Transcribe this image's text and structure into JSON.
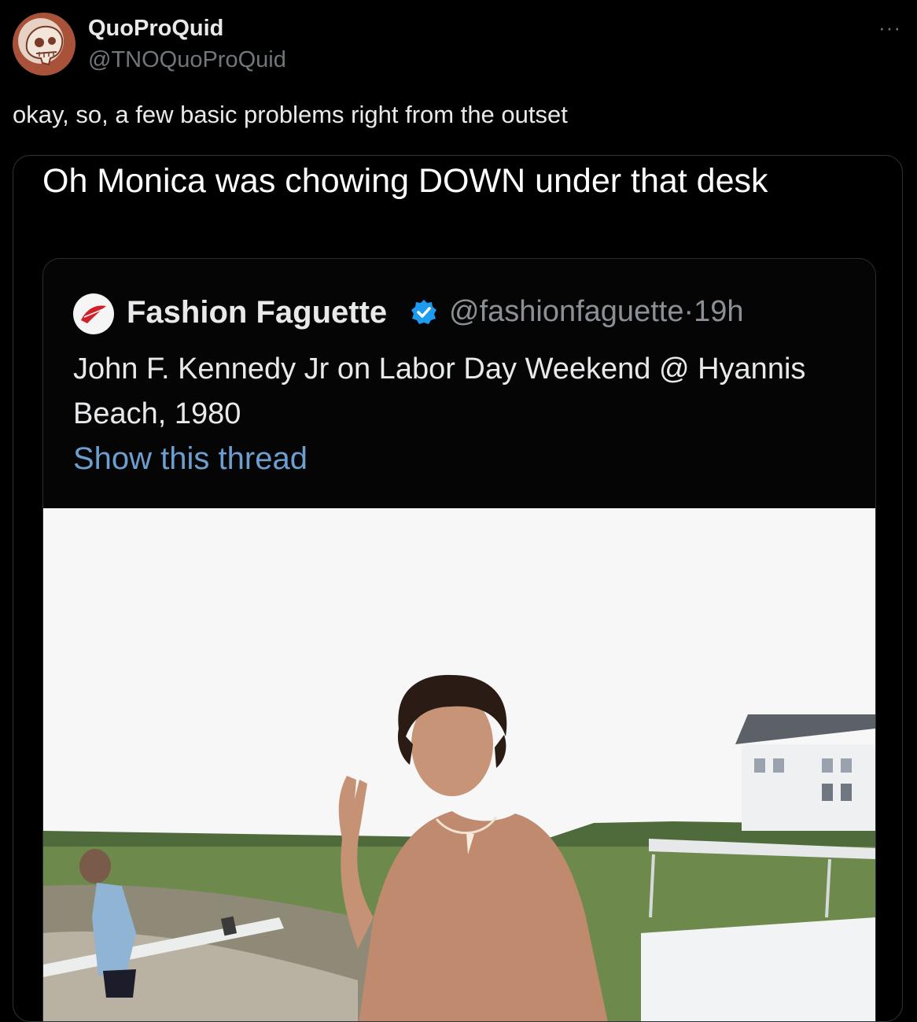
{
  "tweet": {
    "author": {
      "display_name": "QuoProQuid",
      "handle": "@TNOQuoProQuid",
      "avatar_icon": "skull-avatar-icon"
    },
    "more_icon": "more-options-icon",
    "more_glyph": "···",
    "text": "okay, so, a few basic problems right from the outset"
  },
  "media": {
    "caption": "Oh Monica was chowing DOWN under that desk",
    "quoted_post": {
      "display_name": "Fashion Faguette",
      "verified_icon": "verified-badge-icon",
      "handle": "@fashionfaguette",
      "separator": "·",
      "time": "19h",
      "text": "John F. Kennedy Jr on Labor Day Weekend @ Hyannis Beach, 1980",
      "show_thread": "Show this thread",
      "photo_icon": "beach-photo"
    }
  },
  "colors": {
    "background": "#000000",
    "primary_text": "#e7e9ea",
    "secondary_text": "#71767b",
    "link": "#6c9fd0",
    "verified": "#1d9bf0"
  }
}
